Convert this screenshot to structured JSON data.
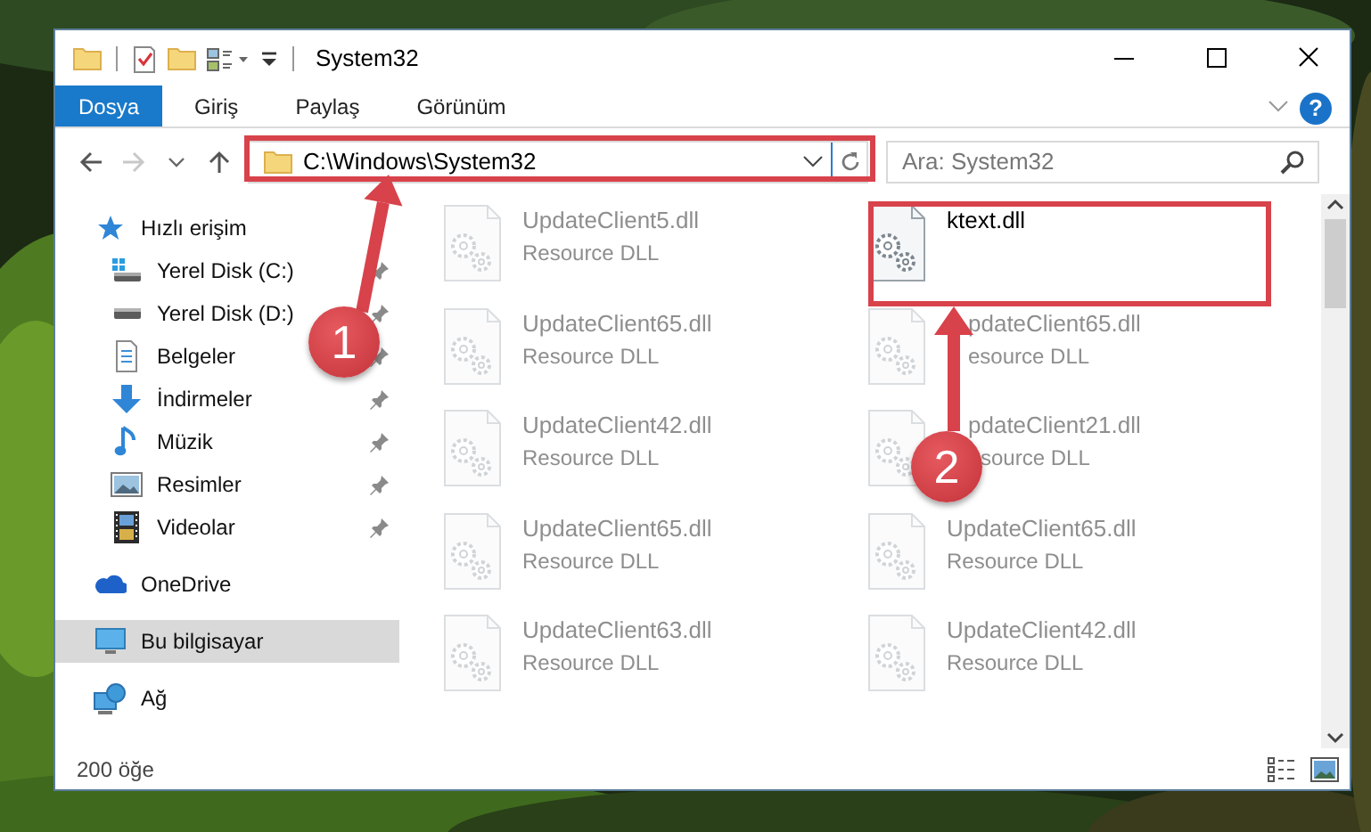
{
  "window": {
    "title": "System32"
  },
  "ribbon_tabs": [
    {
      "label": "Dosya",
      "selected": true
    },
    {
      "label": "Giriş",
      "selected": false
    },
    {
      "label": "Paylaş",
      "selected": false
    },
    {
      "label": "Görünüm",
      "selected": false
    }
  ],
  "help": {
    "label": "?"
  },
  "address_bar": {
    "path": "C:\\Windows\\System32"
  },
  "search": {
    "placeholder": "Ara: System32"
  },
  "navigation": [
    {
      "label": "Hızlı erişim",
      "kind": "quick",
      "selected": false,
      "children": [
        {
          "label": "Yerel Disk (C:)",
          "kind": "drive-c",
          "pinned": true,
          "selected": false
        },
        {
          "label": "Yerel Disk (D:)",
          "kind": "drive",
          "pinned": true,
          "selected": false
        },
        {
          "label": "Belgeler",
          "kind": "documents",
          "pinned": true,
          "selected": false
        },
        {
          "label": "İndirmeler",
          "kind": "downloads",
          "pinned": true,
          "selected": false
        },
        {
          "label": "Müzik",
          "kind": "music",
          "pinned": true,
          "selected": false
        },
        {
          "label": "Resimler",
          "kind": "pictures",
          "pinned": true,
          "selected": false
        },
        {
          "label": "Videolar",
          "kind": "videos",
          "pinned": true,
          "selected": false
        }
      ]
    },
    {
      "label": "OneDrive",
      "kind": "cloud",
      "selected": false
    },
    {
      "label": "Bu bilgisayar",
      "kind": "pc",
      "selected": true
    },
    {
      "label": "Ağ",
      "kind": "network",
      "selected": false
    }
  ],
  "files": [
    {
      "name": "UpdateClient5.dll",
      "type": "Resource DLL",
      "dimmed": true
    },
    {
      "name": "ktext.dll",
      "dimmed": false
    },
    {
      "name": "UpdateClient65.dll",
      "type": "Resource DLL",
      "dimmed": true
    },
    {
      "name": "pdateClient65.dll",
      "type": "esource DLL",
      "dimmed": true
    },
    {
      "name": "UpdateClient42.dll",
      "type": "Resource DLL",
      "dimmed": true
    },
    {
      "name": "pdateClient21.dll",
      "type": "source DLL",
      "dimmed": true
    },
    {
      "name": "UpdateClient65.dll",
      "type": "Resource DLL",
      "dimmed": true
    },
    {
      "name": "UpdateClient65.dll",
      "type": "Resource DLL",
      "dimmed": true
    },
    {
      "name": "UpdateClient63.dll",
      "type": "Resource DLL",
      "dimmed": true
    },
    {
      "name": "UpdateClient42.dll",
      "type": "Resource DLL",
      "dimmed": true
    }
  ],
  "status_bar": {
    "item_count": "200 öğe"
  },
  "annotations": [
    {
      "label": "1"
    },
    {
      "label": "2"
    }
  ]
}
